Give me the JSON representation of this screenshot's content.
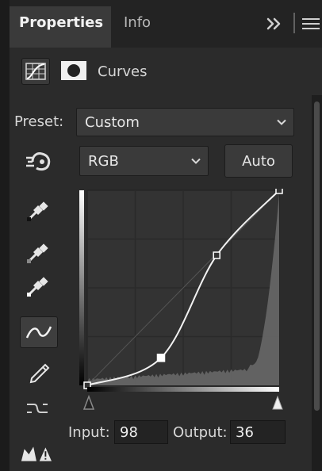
{
  "tabs": {
    "active_label": "Properties",
    "inactive_label": "Info",
    "overflow_icon": "double-chevron-right-icon",
    "menu_icon": "hamburger-menu-icon"
  },
  "adjustment": {
    "title": "Curves",
    "icons": [
      "curves-adjustment-icon",
      "layer-mask-icon"
    ]
  },
  "preset": {
    "label": "Preset:",
    "value": "Custom"
  },
  "channel": {
    "value": "RGB"
  },
  "auto_button": {
    "label": "Auto"
  },
  "tools": [
    "target-adjustment-hand-icon",
    "black-point-eyedropper-icon",
    "gray-point-eyedropper-icon",
    "white-point-eyedropper-icon",
    "curve-points-icon",
    "pencil-icon",
    "smooth-curve-icon",
    "clipping-warning-icon"
  ],
  "curve": {
    "points": [
      {
        "input": 0,
        "output": 0
      },
      {
        "input": 98,
        "output": 36
      },
      {
        "input": 172,
        "output": 170
      },
      {
        "input": 255,
        "output": 255
      }
    ],
    "selected_point_index": 1
  },
  "io": {
    "input_label": "Input:",
    "input_value": "98",
    "output_label": "Output:",
    "output_value": "36"
  },
  "colors": {
    "panel_bg": "#2b2b2b",
    "graph_bg": "#333333",
    "histogram": "#6b6b6b",
    "curve": "#f2f2f2"
  }
}
